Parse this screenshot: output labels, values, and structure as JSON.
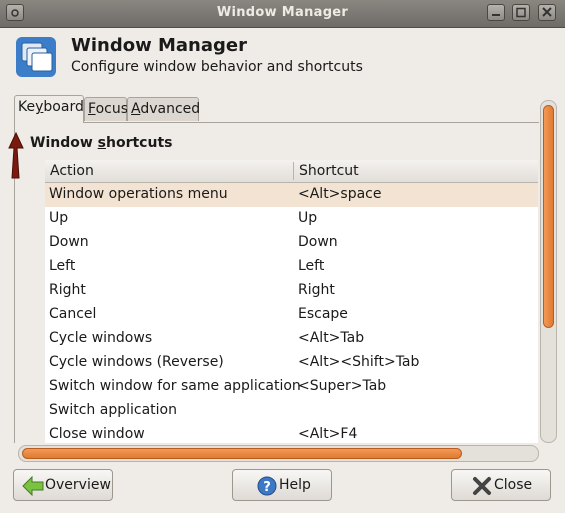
{
  "window": {
    "title": "Window Manager"
  },
  "header": {
    "title": "Window Manager",
    "subtitle": "Configure window behavior and shortcuts"
  },
  "tabs": [
    {
      "label": "Keyboard",
      "underline": "y",
      "active": true
    },
    {
      "label": "Focus",
      "underline": "F",
      "active": false
    },
    {
      "label": "Advanced",
      "underline": "A",
      "active": false
    }
  ],
  "section": {
    "title_pre": "Window ",
    "title_accel": "s",
    "title_post": "hortcuts"
  },
  "table": {
    "columns": [
      "Action",
      "Shortcut"
    ],
    "rows": [
      {
        "action": "Window operations menu",
        "shortcut": "<Alt>space",
        "selected": true
      },
      {
        "action": "Up",
        "shortcut": "Up"
      },
      {
        "action": "Down",
        "shortcut": "Down"
      },
      {
        "action": "Left",
        "shortcut": "Left"
      },
      {
        "action": "Right",
        "shortcut": "Right"
      },
      {
        "action": "Cancel",
        "shortcut": "Escape"
      },
      {
        "action": "Cycle windows",
        "shortcut": "<Alt>Tab"
      },
      {
        "action": "Cycle windows (Reverse)",
        "shortcut": "<Alt><Shift>Tab"
      },
      {
        "action": "Switch window for same application",
        "shortcut": "<Super>Tab"
      },
      {
        "action": "Switch application",
        "shortcut": ""
      },
      {
        "action": "Close window",
        "shortcut": "<Alt>F4"
      }
    ]
  },
  "buttons": {
    "overview": {
      "label": "Overview",
      "icon": "back-arrow-icon"
    },
    "help": {
      "label": "Help",
      "icon": "help-icon"
    },
    "close": {
      "label": "Close",
      "icon": "close-x-icon"
    }
  },
  "colors": {
    "accent": "#e8843e",
    "selection": "#f3e3d2",
    "titlebar": "#7c7973"
  }
}
